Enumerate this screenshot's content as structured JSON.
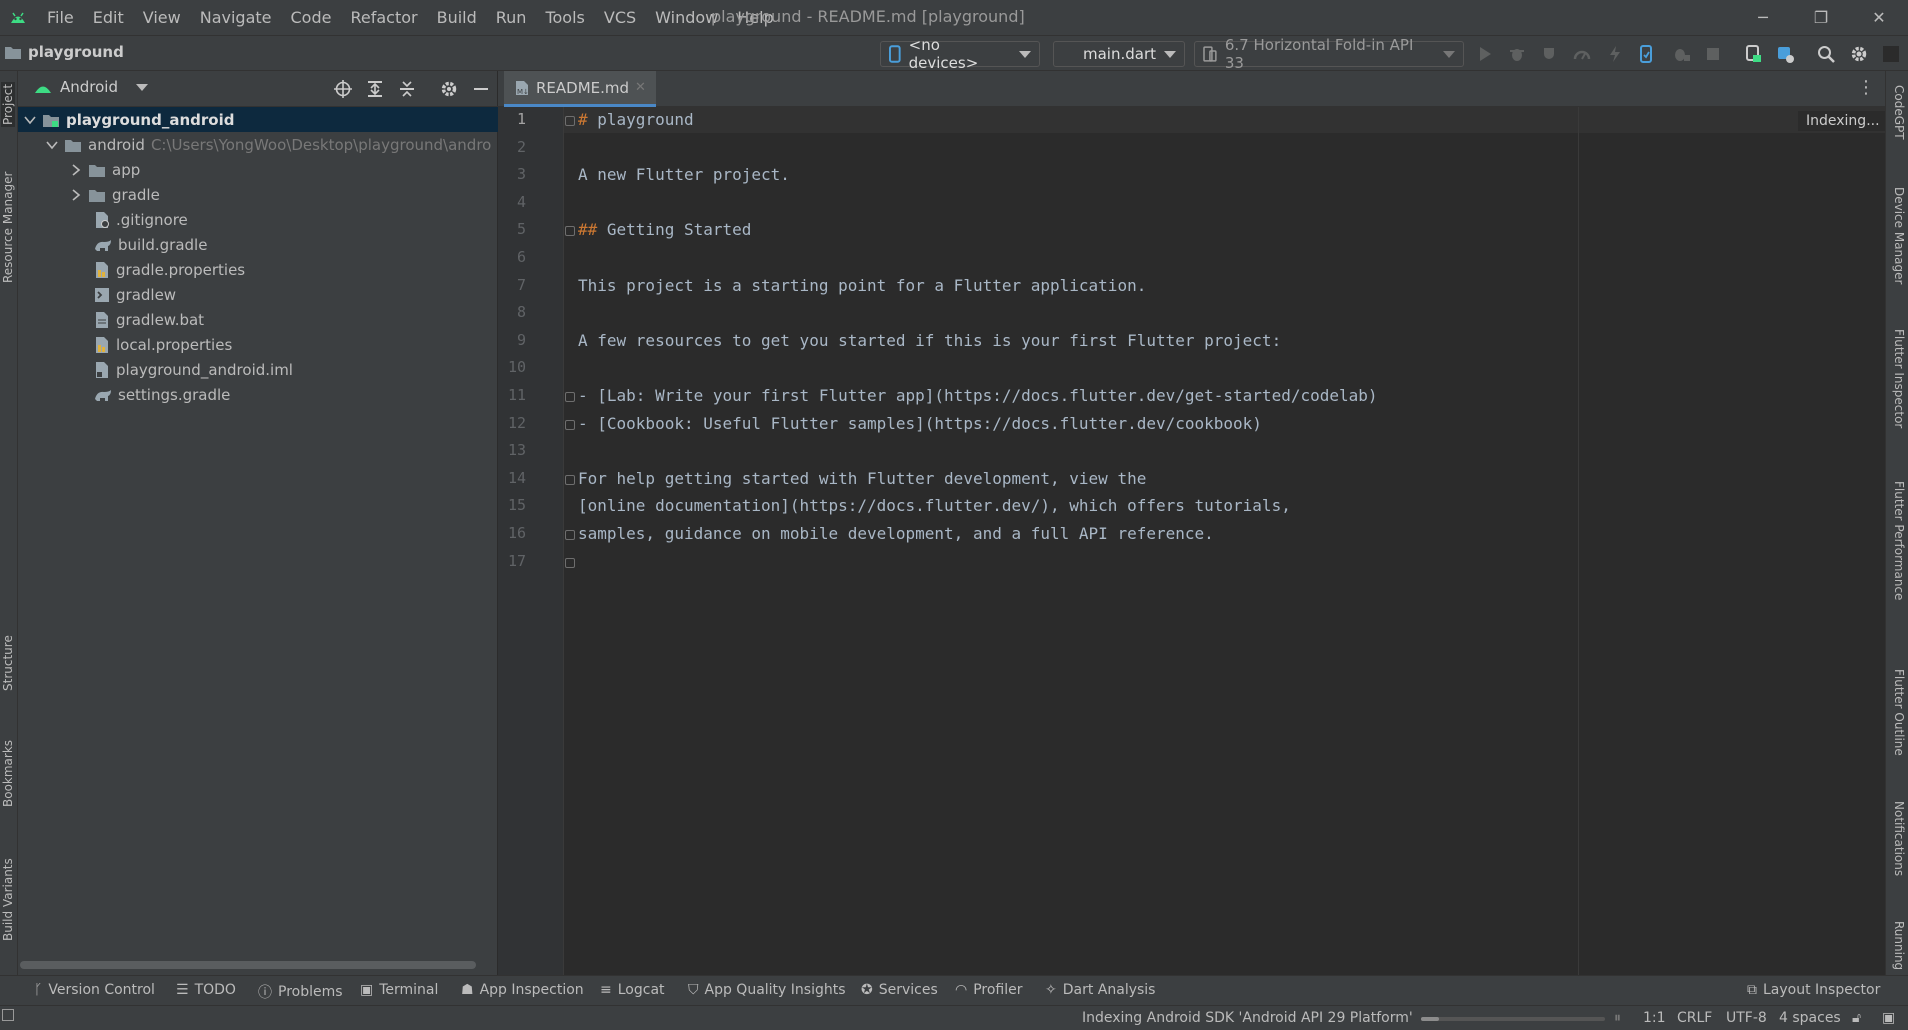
{
  "window": {
    "title": "playground - README.md [playground]",
    "menus": [
      "File",
      "Edit",
      "View",
      "Navigate",
      "Code",
      "Refactor",
      "Build",
      "Run",
      "Tools",
      "VCS",
      "Window",
      "Help"
    ],
    "controls": {
      "minimize": "─",
      "restore": "❐",
      "close": "✕"
    }
  },
  "navbar": {
    "project": "playground",
    "device": "<no devices>",
    "run_config": "main.dart",
    "emulator": "6.7  Horizontal Fold-in API 33"
  },
  "left_strip": [
    "Project",
    "Resource Manager",
    "Structure",
    "Bookmarks",
    "Build Variants"
  ],
  "right_strip": [
    "CodeGPT",
    "Device Manager",
    "Flutter Inspector",
    "Flutter Performance",
    "Flutter Outline",
    "Notifications",
    "Running"
  ],
  "project_panel": {
    "view": "Android",
    "tree": [
      {
        "label": "playground_android",
        "level": 0,
        "type": "module",
        "expanded": true,
        "selected": true
      },
      {
        "label": "android",
        "path": "C:\\Users\\YongWoo\\Desktop\\playground\\andro",
        "level": 1,
        "type": "folder",
        "expanded": true
      },
      {
        "label": "app",
        "level": 2,
        "type": "folder",
        "expanded": false
      },
      {
        "label": "gradle",
        "level": 2,
        "type": "folder",
        "expanded": false
      },
      {
        "label": ".gitignore",
        "level": 2,
        "type": "file"
      },
      {
        "label": "build.gradle",
        "level": 2,
        "type": "gradle"
      },
      {
        "label": "gradle.properties",
        "level": 2,
        "type": "props"
      },
      {
        "label": "gradlew",
        "level": 2,
        "type": "exec"
      },
      {
        "label": "gradlew.bat",
        "level": 2,
        "type": "file"
      },
      {
        "label": "local.properties",
        "level": 2,
        "type": "props"
      },
      {
        "label": "playground_android.iml",
        "level": 2,
        "type": "iml"
      },
      {
        "label": "settings.gradle",
        "level": 2,
        "type": "gradle"
      }
    ]
  },
  "editor": {
    "tab": "README.md",
    "status_hint": "Indexing...",
    "lines": [
      {
        "n": "1",
        "t": "# playground",
        "h": true
      },
      {
        "n": "2",
        "t": ""
      },
      {
        "n": "3",
        "t": "A new Flutter project."
      },
      {
        "n": "4",
        "t": ""
      },
      {
        "n": "5",
        "t": "## Getting Started",
        "h": true
      },
      {
        "n": "6",
        "t": ""
      },
      {
        "n": "7",
        "t": "This project is a starting point for a Flutter application."
      },
      {
        "n": "8",
        "t": ""
      },
      {
        "n": "9",
        "t": "A few resources to get you started if this is your first Flutter project:"
      },
      {
        "n": "10",
        "t": ""
      },
      {
        "n": "11",
        "t": "- [Lab: Write your first Flutter app](https://docs.flutter.dev/get-started/codelab)"
      },
      {
        "n": "12",
        "t": "- [Cookbook: Useful Flutter samples](https://docs.flutter.dev/cookbook)"
      },
      {
        "n": "13",
        "t": ""
      },
      {
        "n": "14",
        "t": "For help getting started with Flutter development, view the"
      },
      {
        "n": "15",
        "t": "[online documentation](https://docs.flutter.dev/), which offers tutorials,"
      },
      {
        "n": "16",
        "t": "samples, guidance on mobile development, and a full API reference."
      },
      {
        "n": "17",
        "t": ""
      }
    ]
  },
  "bottom_tools": [
    "Version Control",
    "TODO",
    "Problems",
    "Terminal",
    "App Inspection",
    "Logcat",
    "App Quality Insights",
    "Services",
    "Profiler",
    "Dart Analysis"
  ],
  "layout_inspector": "Layout Inspector",
  "status": {
    "message": "Indexing Android SDK 'Android API 29 Platform'",
    "progress": 0.1,
    "position": "1:1",
    "line_sep": "CRLF",
    "encoding": "UTF-8",
    "indent": "4 spaces"
  },
  "colors": {
    "accent": "#4a88c7",
    "android_green": "#3ddc84",
    "heading": "#cc7832"
  }
}
